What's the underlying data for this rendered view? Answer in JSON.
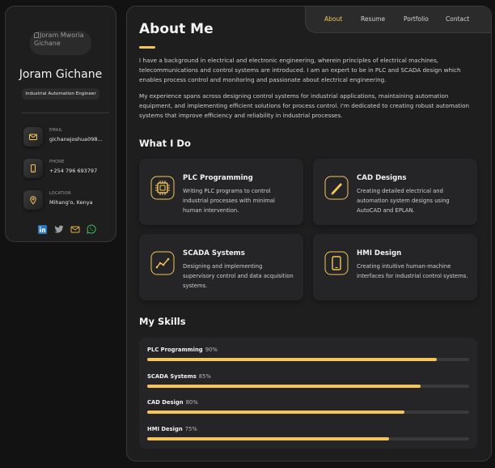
{
  "sidebar": {
    "avatar_alt": "Joram Mworia Gichane",
    "name": "Joram Gichane",
    "title": "Industrial Automation Engineer",
    "contacts": [
      {
        "label": "EMAIL",
        "value": "gichanejoshua098...",
        "icon": "mail-icon"
      },
      {
        "label": "PHONE",
        "value": "+254 796 693797",
        "icon": "phone-icon"
      },
      {
        "label": "LOCATION",
        "value": "Mihang'o, Kenya",
        "icon": "location-icon"
      }
    ],
    "socials": [
      "linkedin-icon",
      "twitter-icon",
      "mail-icon",
      "whatsapp-icon"
    ]
  },
  "nav": {
    "items": [
      "About",
      "Resume",
      "Portfolio",
      "Contact"
    ],
    "active": "About"
  },
  "about": {
    "heading": "About Me",
    "paragraphs": [
      "I have a background in electrical and electronic engineering, wherein principles of electrical machines, telecommunications and control systems are introduced. I am an expert to be in PLC and SCADA design which enables process control and monitoring and passionate about electrical engineering.",
      "My experience spans across designing control systems for industrial applications, maintaining automation equipment, and implementing efficient solutions for process control. I'm dedicated to creating robust automation systems that improve efficiency and reliability in industrial processes."
    ]
  },
  "services": {
    "heading": "What I Do",
    "items": [
      {
        "title": "PLC Programming",
        "text": "Writing PLC programs to control industrial processes with minimal human intervention.",
        "icon": "chip-icon"
      },
      {
        "title": "CAD Designs",
        "text": "Creating detailed electrical and automation system designs using AutoCAD and EPLAN.",
        "icon": "pencil-icon"
      },
      {
        "title": "SCADA Systems",
        "text": "Designing and implementing supervisory control and data acquisition systems.",
        "icon": "chart-line-icon"
      },
      {
        "title": "HMI Design",
        "text": "Creating intuitive human-machine interfaces for industrial control systems.",
        "icon": "tablet-icon"
      }
    ]
  },
  "skills": {
    "heading": "My Skills",
    "items": [
      {
        "name": "PLC Programming",
        "percent": "90%",
        "value": 90
      },
      {
        "name": "SCADA Systems",
        "percent": "85%",
        "value": 85
      },
      {
        "name": "CAD Design",
        "percent": "80%",
        "value": 80
      },
      {
        "name": "HMI Design",
        "percent": "75%",
        "value": 75
      }
    ]
  },
  "colors": {
    "accent": "#f5c55a",
    "background": "#121212",
    "panel": "#1e1e1f",
    "card": "#252527"
  }
}
